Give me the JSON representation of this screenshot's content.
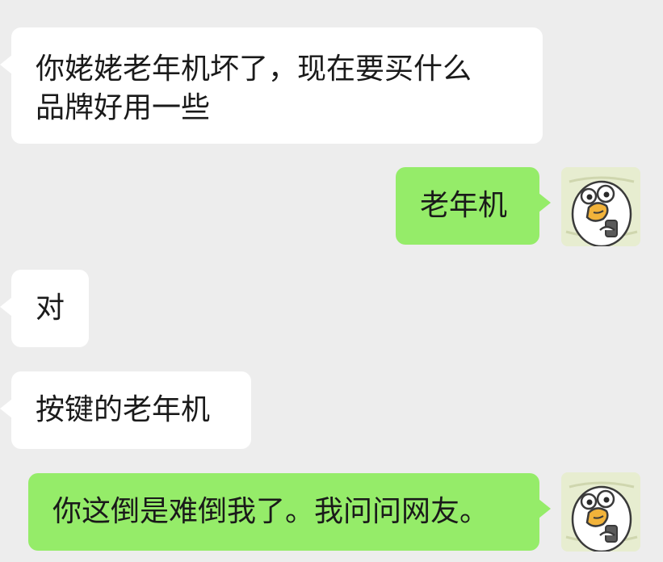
{
  "messages": [
    {
      "side": "in",
      "text_line1": "你姥姥老年机坏了，现在要买什么",
      "text_line2": "品牌好用一些"
    },
    {
      "side": "out",
      "text": "老年机"
    },
    {
      "side": "in",
      "text": "对"
    },
    {
      "side": "in",
      "text": "按键的老年机"
    },
    {
      "side": "out",
      "text": "你这倒是难倒我了。我问问网友。"
    }
  ],
  "avatar": {
    "icon": "cartoon-duck-avatar-icon"
  },
  "colors": {
    "background": "#ededed",
    "incoming": "#ffffff",
    "outgoing": "#95ec69"
  }
}
